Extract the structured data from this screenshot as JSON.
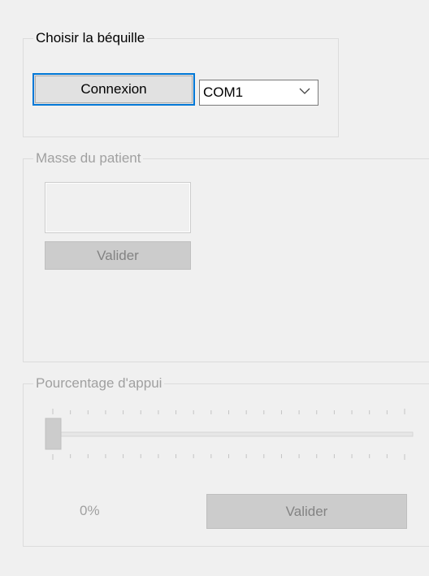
{
  "crutch_group": {
    "title": "Choisir la béquille",
    "connect_label": "Connexion",
    "port_selected": "COM1"
  },
  "mass_group": {
    "title": "Masse du patient",
    "mass_value": "",
    "validate_label": "Valider"
  },
  "percent_group": {
    "title": "Pourcentage d'appui",
    "slider_value_percent": 0,
    "percent_text": "0%",
    "validate_label": "Valider"
  },
  "colors": {
    "focus_border": "#0078d7",
    "disabled_text": "#a0a0a0",
    "disabled_button_bg": "#cccccc",
    "window_bg": "#f0f0f0"
  },
  "icons": {
    "dropdown": "chevron-down-icon"
  }
}
